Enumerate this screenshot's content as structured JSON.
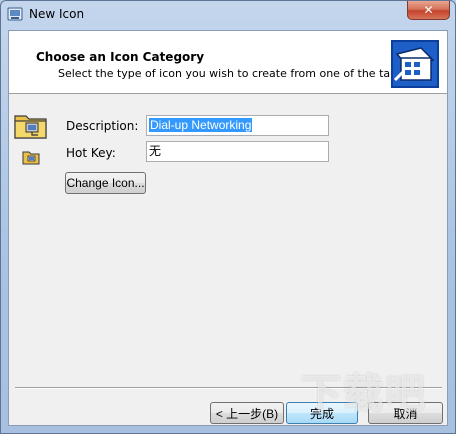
{
  "window": {
    "title": "New Icon",
    "close_label": "✕"
  },
  "header": {
    "title": "Choose an Icon Category",
    "subtitle": "Select the type of icon you wish to create from one of the tabs below"
  },
  "form": {
    "description_label": "Description:",
    "description_value": "Dial-up Networking",
    "hotkey_label": "Hot Key:",
    "hotkey_value": "无",
    "change_icon_label": "Change Icon..."
  },
  "footer": {
    "back_label": "< 上一步(B)",
    "finish_label": "完成",
    "cancel_label": "取消"
  },
  "icons": {
    "app": "app-icon",
    "header": "wizard-icon",
    "large": "folder-network-icon",
    "small": "folder-small-icon"
  },
  "watermark": "下载吧"
}
